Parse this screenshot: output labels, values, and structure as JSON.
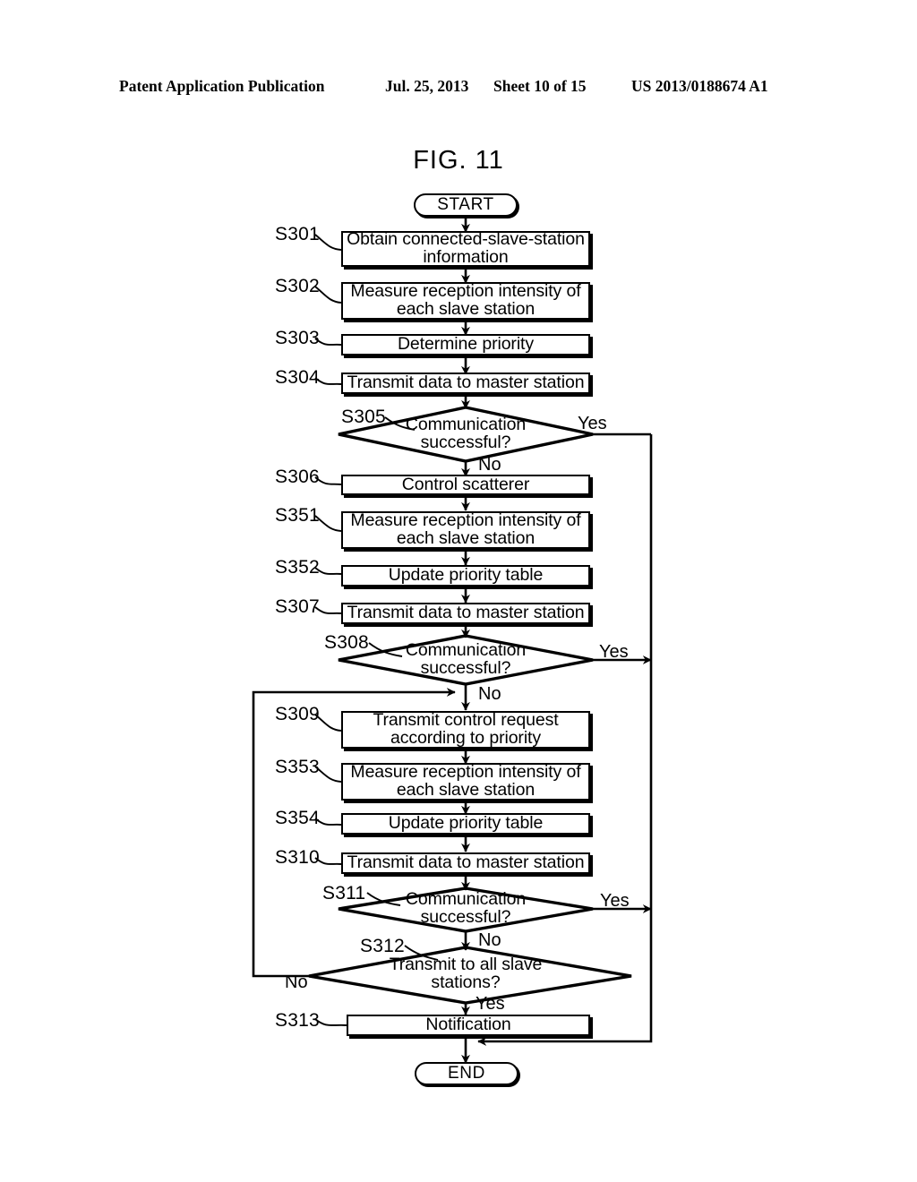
{
  "header": {
    "publication": "Patent Application Publication",
    "date": "Jul. 25, 2013",
    "sheet": "Sheet 10 of 15",
    "number": "US 2013/0188674 A1"
  },
  "figure": {
    "title": "FIG. 11",
    "type": "flowchart"
  },
  "nodes": {
    "start": {
      "label": "START",
      "shape": "terminator"
    },
    "s301": {
      "ref": "S301",
      "label": "Obtain connected-slave-station information",
      "shape": "process"
    },
    "s302": {
      "ref": "S302",
      "label": "Measure reception intensity of each slave station",
      "shape": "process"
    },
    "s303": {
      "ref": "S303",
      "label": "Determine priority",
      "shape": "process"
    },
    "s304": {
      "ref": "S304",
      "label": "Transmit data to master station",
      "shape": "process"
    },
    "s305": {
      "ref": "S305",
      "label": "Communication successful?",
      "shape": "decision"
    },
    "s306": {
      "ref": "S306",
      "label": "Control scatterer",
      "shape": "process"
    },
    "s351": {
      "ref": "S351",
      "label": "Measure reception intensity of each slave station",
      "shape": "process"
    },
    "s352": {
      "ref": "S352",
      "label": "Update priority table",
      "shape": "process"
    },
    "s307": {
      "ref": "S307",
      "label": "Transmit data to master station",
      "shape": "process"
    },
    "s308": {
      "ref": "S308",
      "label": "Communication successful?",
      "shape": "decision"
    },
    "s309": {
      "ref": "S309",
      "label": "Transmit control request according to priority",
      "shape": "process"
    },
    "s353": {
      "ref": "S353",
      "label": "Measure reception intensity of each slave station",
      "shape": "process"
    },
    "s354": {
      "ref": "S354",
      "label": "Update priority table",
      "shape": "process"
    },
    "s310": {
      "ref": "S310",
      "label": "Transmit data to master station",
      "shape": "process"
    },
    "s311": {
      "ref": "S311",
      "label": "Communication successful?",
      "shape": "decision"
    },
    "s312": {
      "ref": "S312",
      "label": "Transmit to all slave stations?",
      "shape": "decision"
    },
    "s313": {
      "ref": "S313",
      "label": "Notification",
      "shape": "process"
    },
    "end": {
      "label": "END",
      "shape": "terminator"
    }
  },
  "branch_labels": {
    "s305_yes": "Yes",
    "s305_no": "No",
    "s308_yes": "Yes",
    "s308_no": "No",
    "s311_yes": "Yes",
    "s311_no": "No",
    "s312_no": "No",
    "s312_yes": "Yes"
  },
  "colors": {
    "ink": "#000000",
    "paper": "#ffffff"
  }
}
